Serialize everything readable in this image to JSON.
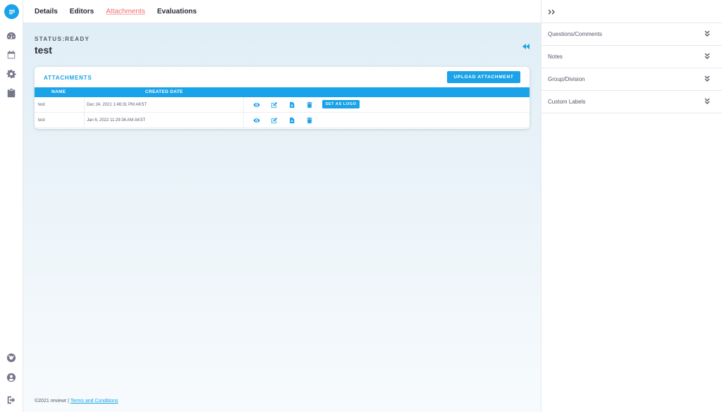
{
  "rail": {
    "icons": [
      "reviewr-logo-icon",
      "dashboard-icon",
      "calendar-icon",
      "gear-icon",
      "clipboard-icon",
      "help-icon",
      "user-icon",
      "logout-icon"
    ]
  },
  "tabs": [
    {
      "label": "Details",
      "active": false
    },
    {
      "label": "Editors",
      "active": false
    },
    {
      "label": "Attachments",
      "active": true
    },
    {
      "label": "Evaluations",
      "active": false
    }
  ],
  "main": {
    "status": "STATUS:READY",
    "title": "test"
  },
  "attachments": {
    "heading": "ATTACHMENTS",
    "upload_label": "UPLOAD ATTACHMENT",
    "columns": [
      "NAME",
      "CREATED DATE"
    ],
    "rows": [
      {
        "name": "test",
        "created": "Dec 24, 2021 1:46:31 PM AKST",
        "set_logo": "SET AS LOGO"
      },
      {
        "name": "test",
        "created": "Jan 6, 2022 11:29:36 AM AKST"
      }
    ],
    "actions": [
      "eye-icon",
      "edit-icon",
      "file-download-icon",
      "trash-icon"
    ]
  },
  "footer": {
    "copyright": "©2021 reviewr |",
    "terms": "Terms and Conditions"
  },
  "right_panel": {
    "sections": [
      "Questions/Comments",
      "Notes",
      "Group/Division",
      "Custom Labels"
    ]
  },
  "colors": {
    "accent": "#1aa3e8",
    "active_tab": "#f06c6c",
    "text": "#2b2b3a"
  }
}
